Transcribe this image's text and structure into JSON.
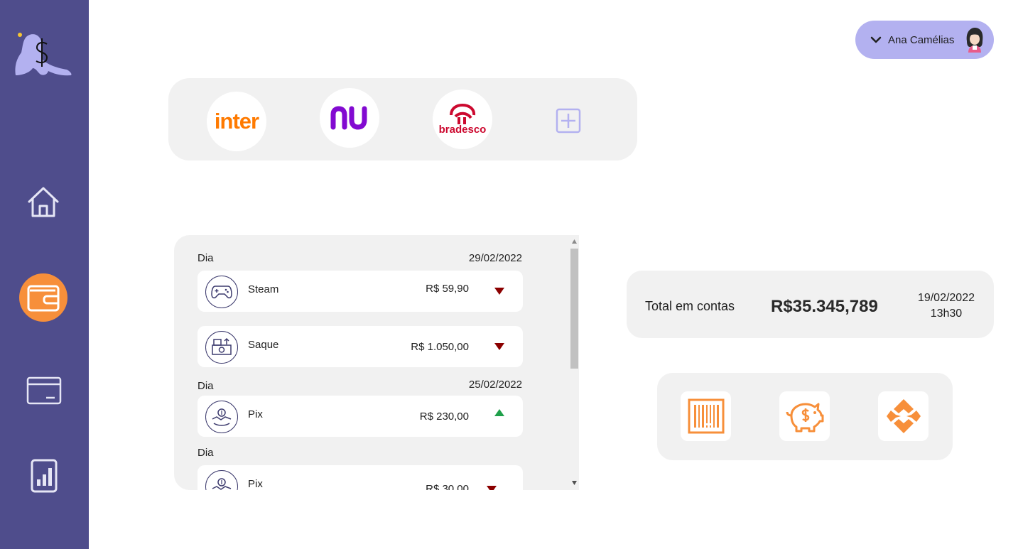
{
  "user": {
    "name": "Ana Camélias"
  },
  "banks": [
    {
      "label": "inter"
    },
    {
      "label": "nu"
    },
    {
      "label": "bradesco"
    }
  ],
  "transactions": {
    "groups": [
      {
        "day_label": "Dia",
        "date": "29/02/2022",
        "items": [
          {
            "name": "Steam",
            "amount": "R$ 59,90",
            "direction": "down"
          },
          {
            "name": "Saque",
            "amount": "R$ 1.050,00",
            "direction": "down"
          }
        ]
      },
      {
        "day_label": "Dia",
        "date": "25/02/2022",
        "items": [
          {
            "name": "Pix",
            "amount": "R$ 230,00",
            "direction": "up"
          }
        ]
      },
      {
        "day_label": "Dia",
        "date": "",
        "items": [
          {
            "name": "Pix",
            "amount": "R$ 30,00",
            "direction": "down"
          }
        ]
      }
    ]
  },
  "summary": {
    "label": "Total em contas",
    "value": "R$35.345,789",
    "date": "19/02/2022",
    "time": "13h30"
  },
  "colors": {
    "sidebar": "#4f4d8c",
    "accent": "#f78f3a",
    "user_chip": "#b3b1f0",
    "panel": "#f1f1f1",
    "arrow_down": "#8b0000",
    "arrow_up": "#1fa04a"
  },
  "icons": {
    "logo": "seal-dollar-logo",
    "nav": [
      "home-icon",
      "wallet-icon",
      "card-icon",
      "report-icon"
    ],
    "actions": [
      "barcode-icon",
      "piggy-bank-icon",
      "pix-icon"
    ]
  }
}
